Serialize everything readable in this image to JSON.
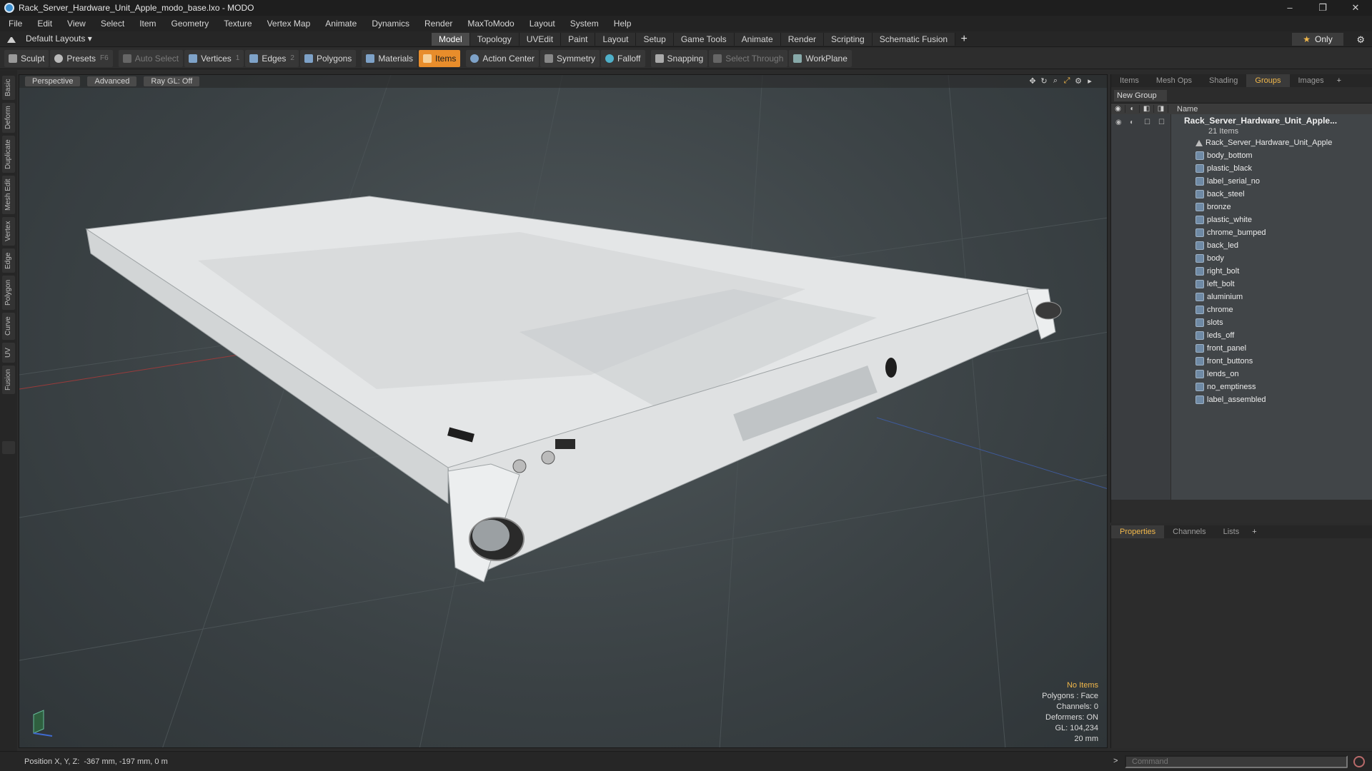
{
  "window": {
    "title": "Rack_Server_Hardware_Unit_Apple_modo_base.lxo - MODO",
    "controls": [
      "–",
      "❐",
      "✕"
    ]
  },
  "menu": [
    "File",
    "Edit",
    "View",
    "Select",
    "Item",
    "Geometry",
    "Texture",
    "Vertex Map",
    "Animate",
    "Dynamics",
    "Render",
    "MaxToModo",
    "Layout",
    "System",
    "Help"
  ],
  "layout": {
    "selector": "Default Layouts ▾",
    "tabs": [
      "Model",
      "Topology",
      "UVEdit",
      "Paint",
      "Layout",
      "Setup",
      "Game Tools",
      "Animate",
      "Render",
      "Scripting",
      "Schematic Fusion"
    ],
    "active_tab": "Model",
    "plus": "+",
    "only_label": "Only"
  },
  "toolbar": {
    "sculpt": "Sculpt",
    "presets": "Presets",
    "presets_key": "F6",
    "auto_select": "Auto Select",
    "vertices": "Vertices",
    "vertices_key": "1",
    "edges": "Edges",
    "edges_key": "2",
    "polygons": "Polygons",
    "materials": "Materials",
    "items": "Items",
    "action_center": "Action Center",
    "symmetry": "Symmetry",
    "falloff": "Falloff",
    "snapping": "Snapping",
    "select_through": "Select Through",
    "workplane": "WorkPlane"
  },
  "left_tabs": [
    "Basic",
    "Deform",
    "Duplicate",
    "Mesh Edit",
    "Vertex",
    "Edge",
    "Polygon",
    "Curve",
    "UV",
    "Fusion"
  ],
  "viewport": {
    "view": "Perspective",
    "advanced": "Advanced",
    "raygl": "Ray GL: Off",
    "info": {
      "selection": "No Items",
      "polygons": "Polygons : Face",
      "channels": "Channels: 0",
      "deformers": "Deformers: ON",
      "gl": "GL: 104,234",
      "scale": "20 mm"
    }
  },
  "right_panel": {
    "tabs": [
      "Items",
      "Mesh Ops",
      "Shading",
      "Groups",
      "Images"
    ],
    "active_tab": "Groups",
    "new_group": "New Group",
    "name_col": "Name",
    "group_name": "Rack_Server_Hardware_Unit_Apple...",
    "group_count": "21 Items",
    "items": [
      "Rack_Server_Hardware_Unit_Apple",
      "body_bottom",
      "plastic_black",
      "label_serial_no",
      "back_steel",
      "bronze",
      "plastic_white",
      "chrome_bumped",
      "back_led",
      "body",
      "right_bolt",
      "left_bolt",
      "aluminium",
      "chrome",
      "slots",
      "leds_off",
      "front_panel",
      "front_buttons",
      "lends_on",
      "no_emptiness",
      "label_assembled"
    ]
  },
  "props_panel": {
    "tabs": [
      "Properties",
      "Channels",
      "Lists"
    ],
    "active_tab": "Properties"
  },
  "status": {
    "position_label": "Position X, Y, Z:",
    "position_value": "-367 mm, -197 mm, 0 m",
    "command_placeholder": "Command"
  },
  "colors": {
    "accent": "#e88d2b",
    "highlight_text": "#f2b84b"
  }
}
